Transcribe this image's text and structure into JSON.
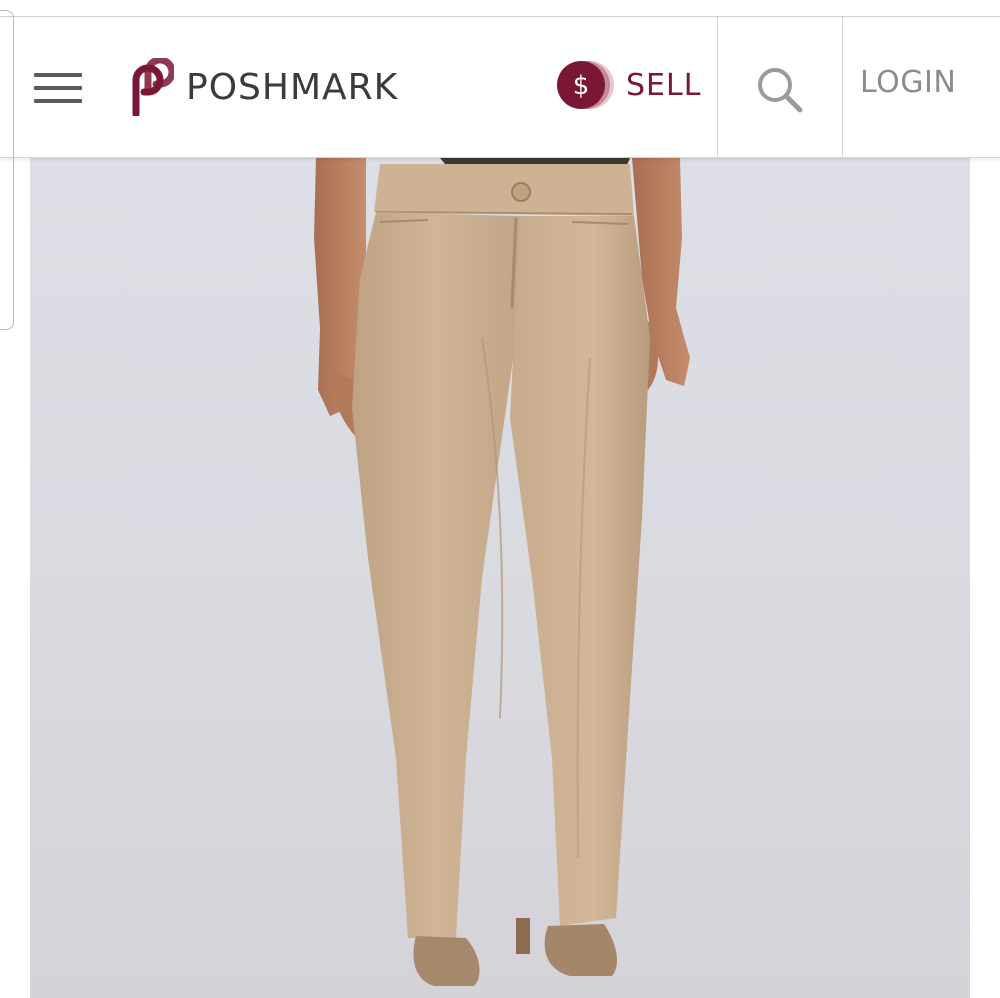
{
  "header": {
    "brand": "POSHMARK",
    "sell_label": "SELL",
    "sell_symbol": "$",
    "login_label": "LOGIN",
    "menu_icon": "hamburger-menu-icon",
    "search_icon": "search-icon"
  },
  "colors": {
    "brand": "#7a1734",
    "text_dark": "#3b3b3b",
    "text_muted": "#8c8c8c",
    "photo_background": "#dcdce3",
    "pants": "#c9ad8e"
  },
  "listing": {
    "image_alt": "",
    "product_icon": "tan-trousers-photo"
  }
}
